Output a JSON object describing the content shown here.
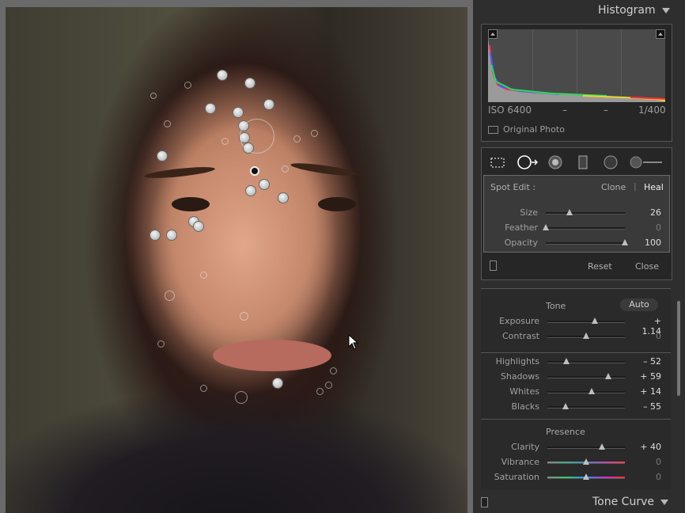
{
  "histogram": {
    "title": "Histogram",
    "iso": "ISO 6400",
    "focal": "–",
    "aperture": "–",
    "shutter": "1/400",
    "original_photo_label": "Original Photo"
  },
  "tools": [
    "crop-overlay-icon",
    "spot-removal-icon",
    "red-eye-icon",
    "graduated-filter-icon",
    "radial-filter-icon",
    "adjustment-brush-icon"
  ],
  "spot_edit": {
    "label": "Spot Edit :",
    "clone_label": "Clone",
    "divider": "|",
    "heal_label": "Heal",
    "size_label": "Size",
    "size_value": "26",
    "size_fraction": 0.3,
    "feather_label": "Feather",
    "feather_value": "0",
    "feather_fraction": 0.0,
    "opacity_label": "Opacity",
    "opacity_value": "100",
    "opacity_fraction": 1.0,
    "reset_label": "Reset",
    "close_label": "Close"
  },
  "basic": {
    "tone_label": "Tone",
    "auto_label": "Auto",
    "exposure_label": "Exposure",
    "exposure_value": "+ 1.14",
    "exposure_fraction": 0.61,
    "contrast_label": "Contrast",
    "contrast_value": "0",
    "contrast_fraction": 0.5,
    "highlights_label": "Highlights",
    "highlights_value": "– 52",
    "highlights_fraction": 0.24,
    "shadows_label": "Shadows",
    "shadows_value": "+ 59",
    "shadows_fraction": 0.79,
    "whites_label": "Whites",
    "whites_value": "+ 14",
    "whites_fraction": 0.57,
    "blacks_label": "Blacks",
    "blacks_value": "– 55",
    "blacks_fraction": 0.23,
    "presence_label": "Presence",
    "clarity_label": "Clarity",
    "clarity_value": "+ 40",
    "clarity_fraction": 0.7,
    "vibrance_label": "Vibrance",
    "vibrance_value": "0",
    "vibrance_fraction": 0.5,
    "saturation_label": "Saturation",
    "saturation_value": "0",
    "saturation_fraction": 0.5
  },
  "tone_curve": {
    "title": "Tone Curve"
  },
  "colors": {
    "panel_bg": "#2e2e2e",
    "accent_text": "#dedede"
  }
}
